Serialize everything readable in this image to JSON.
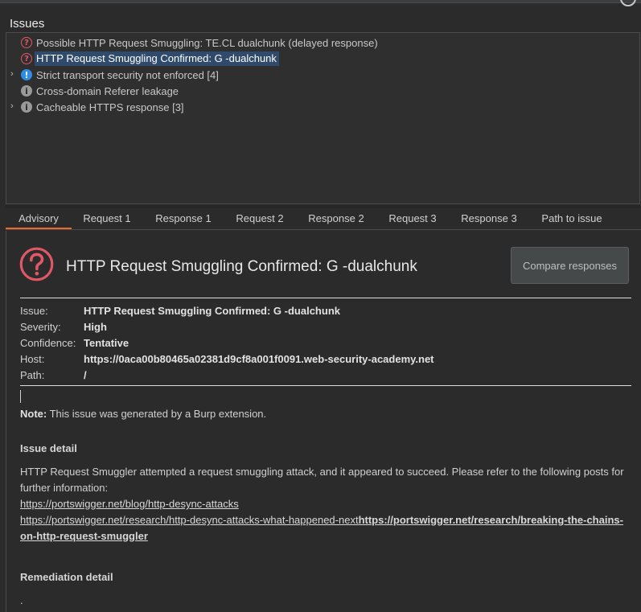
{
  "issues_title": "Issues",
  "issues": [
    {
      "label": "Possible HTTP Request Smuggling: TE.CL dualchunk (delayed response)",
      "icon": "question-icon",
      "selected": false,
      "expandable": false
    },
    {
      "label": "HTTP Request Smuggling Confirmed: G -dualchunk",
      "icon": "question-icon",
      "selected": true,
      "expandable": false
    },
    {
      "label": "Strict transport security not enforced [4]",
      "icon": "warning-icon",
      "selected": false,
      "expandable": true
    },
    {
      "label": "Cross-domain Referer leakage",
      "icon": "info-icon",
      "selected": false,
      "expandable": false
    },
    {
      "label": "Cacheable HTTPS response [3]",
      "icon": "info-icon",
      "selected": false,
      "expandable": true
    }
  ],
  "tabs": [
    "Advisory",
    "Request 1",
    "Response 1",
    "Request 2",
    "Response 2",
    "Request 3",
    "Response 3",
    "Path to issue"
  ],
  "active_tab": "Advisory",
  "advisory": {
    "title": "HTTP Request Smuggling Confirmed: G -dualchunk",
    "compare_button": "Compare responses",
    "fields": {
      "issue_label": "Issue:",
      "issue_value": "HTTP Request Smuggling Confirmed: G -dualchunk",
      "severity_label": "Severity:",
      "severity_value": "High",
      "confidence_label": "Confidence:",
      "confidence_value": "Tentative",
      "host_label": "Host:",
      "host_value": "https://0aca00b80465a02381d9cf8a001f0091.web-security-academy.net",
      "path_label": "Path:",
      "path_value": "/"
    },
    "note_label": "Note:",
    "note_text": " This issue was generated by a Burp extension.",
    "issue_detail_heading": "Issue detail",
    "issue_detail_text": "HTTP Request Smuggler attempted a request smuggling attack, and it appeared to succeed. Please refer to the following posts for further information:",
    "links": {
      "link1": "https://portswigger.net/blog/http-desync-attacks",
      "link2": "https://portswigger.net/research/http-desync-attacks-what-happened-next",
      "link3": "https://portswigger.net/research/breaking-the-chains-on-http-request-smuggler"
    },
    "remediation_heading": "Remediation detail",
    "remediation_text": "."
  },
  "colors": {
    "accent_tab": "#e8682d",
    "selection": "#2f4a6b",
    "high_icon": "#e05866",
    "warning_icon": "#2f8de4"
  }
}
